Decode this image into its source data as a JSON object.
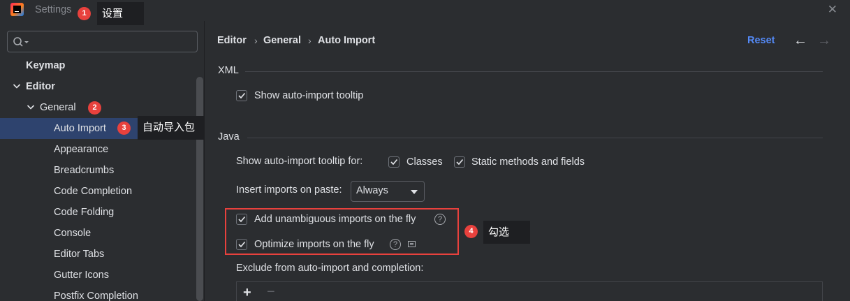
{
  "window": {
    "title": "Settings",
    "close_glyph": "✕"
  },
  "annotations": {
    "callout_settings": "设置",
    "callout_auto_import": "自动导入包",
    "callout_check": "勾选",
    "badge_1": "1",
    "badge_2": "2",
    "badge_3": "3",
    "badge_4": "4",
    "highlight_color": "#e8413d"
  },
  "sidebar": {
    "search_placeholder": "",
    "items": [
      {
        "label": "Keymap"
      },
      {
        "label": "Editor"
      },
      {
        "label": "General"
      },
      {
        "label": "Auto Import"
      },
      {
        "label": "Appearance"
      },
      {
        "label": "Breadcrumbs"
      },
      {
        "label": "Code Completion"
      },
      {
        "label": "Code Folding"
      },
      {
        "label": "Console"
      },
      {
        "label": "Editor Tabs"
      },
      {
        "label": "Gutter Icons"
      },
      {
        "label": "Postfix Completion"
      }
    ]
  },
  "breadcrumb": {
    "items": [
      "Editor",
      "General",
      "Auto Import"
    ],
    "separator": "›"
  },
  "header": {
    "reset_label": "Reset",
    "back_glyph": "←",
    "forward_glyph": "→"
  },
  "xml": {
    "title": "XML",
    "show_tooltip_label": "Show auto-import tooltip",
    "show_tooltip_checked": true
  },
  "java": {
    "title": "Java",
    "tooltip_for_label": "Show auto-import tooltip for:",
    "classes_label": "Classes",
    "classes_checked": true,
    "static_label": "Static methods and fields",
    "static_checked": true,
    "insert_on_paste_label": "Insert imports on paste:",
    "insert_on_paste_value": "Always",
    "unambiguous_label": "Add unambiguous imports on the fly",
    "unambiguous_checked": true,
    "optimize_label": "Optimize imports on the fly",
    "optimize_checked": true,
    "help_glyph": "?",
    "exclude_label": "Exclude from auto-import and completion:",
    "add_glyph": "+",
    "remove_glyph": "−"
  },
  "colors": {
    "background": "#2b2d30",
    "selection": "#2e436e",
    "link": "#548af7",
    "annotation_red": "#e8413d"
  }
}
